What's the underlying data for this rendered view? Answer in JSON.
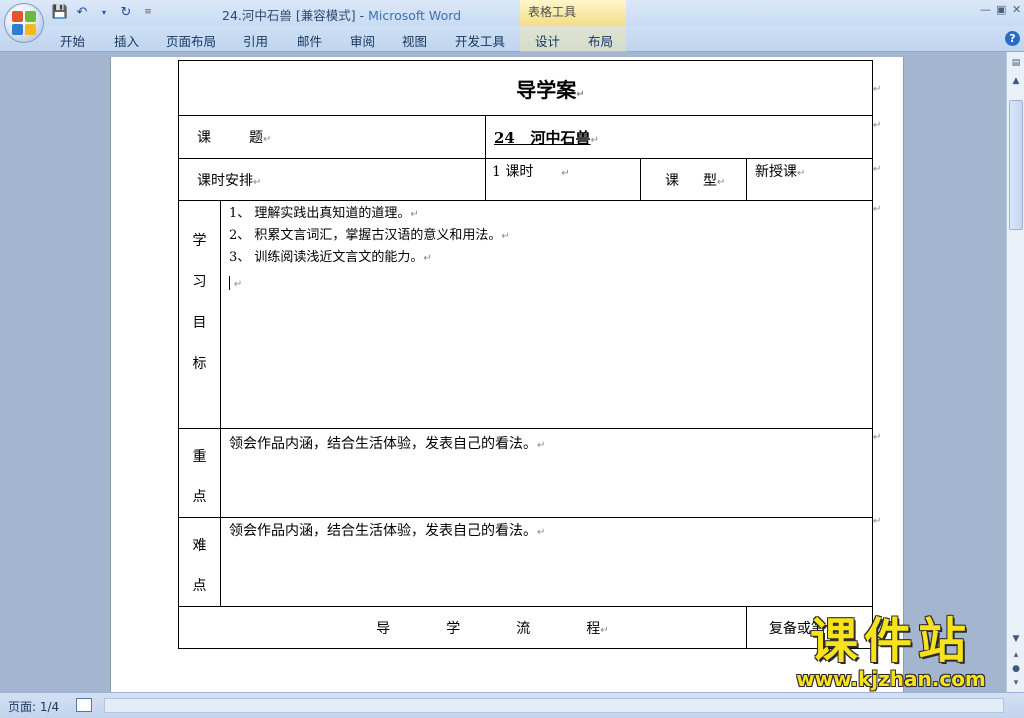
{
  "titlebar": {
    "document_title": "24.河中石兽 [兼容模式] - ",
    "app_name": "Microsoft Word",
    "context_label": "表格工具"
  },
  "ribbon": {
    "tabs": [
      "开始",
      "插入",
      "页面布局",
      "引用",
      "邮件",
      "审阅",
      "视图",
      "开发工具",
      "设计",
      "布局"
    ]
  },
  "document": {
    "heading": "导学案",
    "lesson_label_1": "课",
    "lesson_label_2": "题",
    "lesson_number": "24",
    "lesson_title": "河中石兽",
    "schedule_label": "课时安排",
    "schedule_value": "1 课时",
    "type_label_1": "课",
    "type_label_2": "型",
    "type_value": "新授课",
    "objectives_label": [
      "学",
      "习",
      "目",
      "标"
    ],
    "objectives": [
      "1、 理解实践出真知道的道理。",
      "2、 积累文言词汇，掌握古汉语的意义和用法。",
      "3、 训练阅读浅近文言文的能力。"
    ],
    "key_label": [
      "重",
      "点"
    ],
    "key_text": "领会作品内涵，结合生活体验，发表自己的看法。",
    "difficulty_label": [
      "难",
      "点"
    ],
    "difficulty_text": "领会作品内涵，结合生活体验，发表自己的看法。",
    "process_label": [
      "导",
      "学",
      "流",
      "程"
    ],
    "notes_label": "复备或笔记"
  },
  "statusbar": {
    "page_info": "页面: 1/4"
  },
  "watermark": {
    "top": "课件站",
    "bottom": "www.kjzhan.com"
  }
}
